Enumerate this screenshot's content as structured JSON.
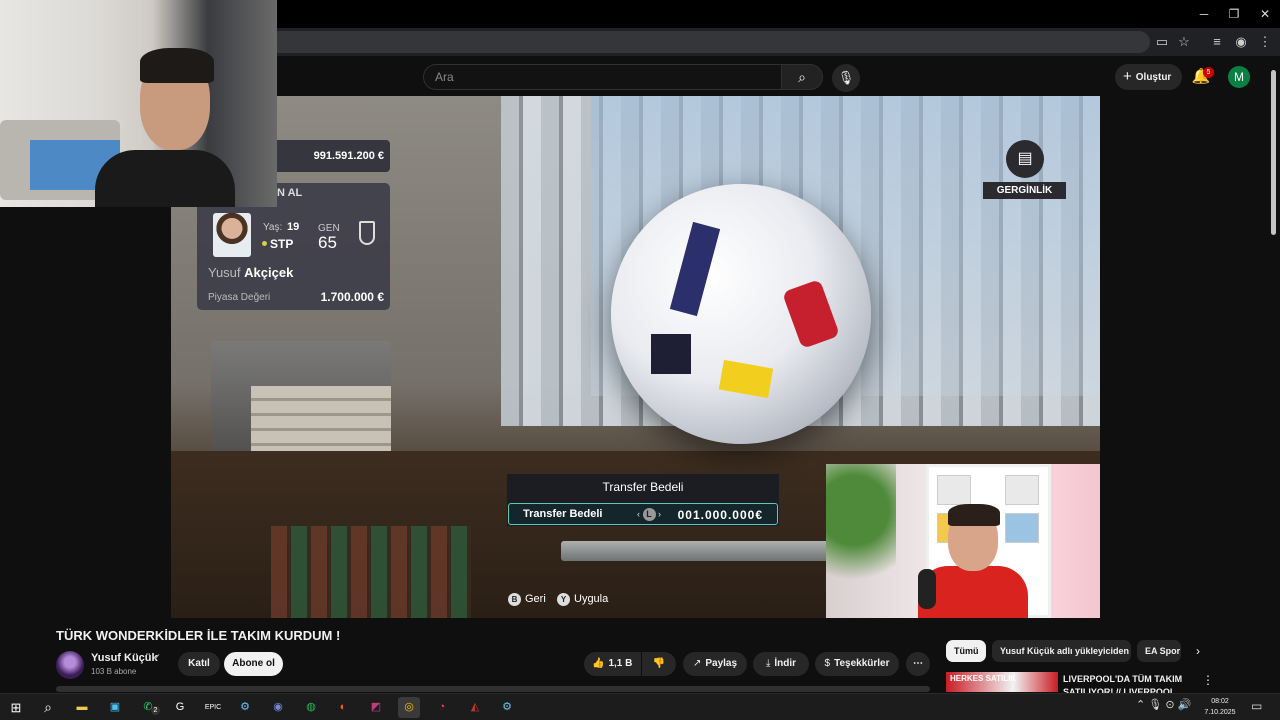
{
  "browser": {
    "window_controls": {
      "minimize": "─",
      "restore": "❐",
      "close": "✕"
    }
  },
  "masthead": {
    "search_placeholder": "Ara",
    "create_label": "Oluştur",
    "notification_count": "5",
    "avatar_letter": "M"
  },
  "game": {
    "budget": "991.591.200 €",
    "card_header": "N AL",
    "age_label": "Yaş:",
    "age": "19",
    "position": "STP",
    "gen_label": "GEN",
    "gen": "65",
    "player_first": "Yusuf",
    "player_last": "Akçiçek",
    "market_value_label": "Piyasa Değeri",
    "market_value": "1.700.000 €",
    "tension_label": "GERGİNLİK",
    "transfer_title": "Transfer Bedeli",
    "transfer_row_label": "Transfer Bedeli",
    "transfer_stick": "L",
    "transfer_value": "001.000.000€",
    "back_key": "B",
    "back_label": "Geri",
    "apply_key": "Y",
    "apply_label": "Uygula"
  },
  "video": {
    "title": "TÜRK WONDERKİDLER İLE TAKIM KURDUM !",
    "channel_name": "Yusuf Küçük",
    "subscribers": "103 B abone",
    "join_label": "Katıl",
    "subscribe_label": "Abone ol",
    "likes": "1,1 B",
    "share_label": "Paylaş",
    "download_label": "İndir",
    "thanks_label": "Teşekkürler"
  },
  "sidebar": {
    "chips": [
      "Tümü",
      "Yusuf Küçük adlı yükleyiciden",
      "EA Spor"
    ],
    "recommendation_thumb_text": "HERKES SATILIK",
    "recommendation_title": "LIVERPOOL'DA TÜM TAKIM SATILIYOR! // LIVERPOOL"
  },
  "taskbar": {
    "time": "08:02",
    "date": "7.10.2025",
    "whatsapp_badge": "2",
    "icons": [
      "windows-icon",
      "search-icon",
      "file-explorer-icon",
      "store-icon",
      "whatsapp-icon",
      "app-icon",
      "epic-games-icon",
      "steam-icon",
      "discord-icon",
      "spotify-icon",
      "app-icon",
      "app-icon",
      "chrome-icon",
      "app-icon",
      "app-icon",
      "steam-icon"
    ]
  }
}
